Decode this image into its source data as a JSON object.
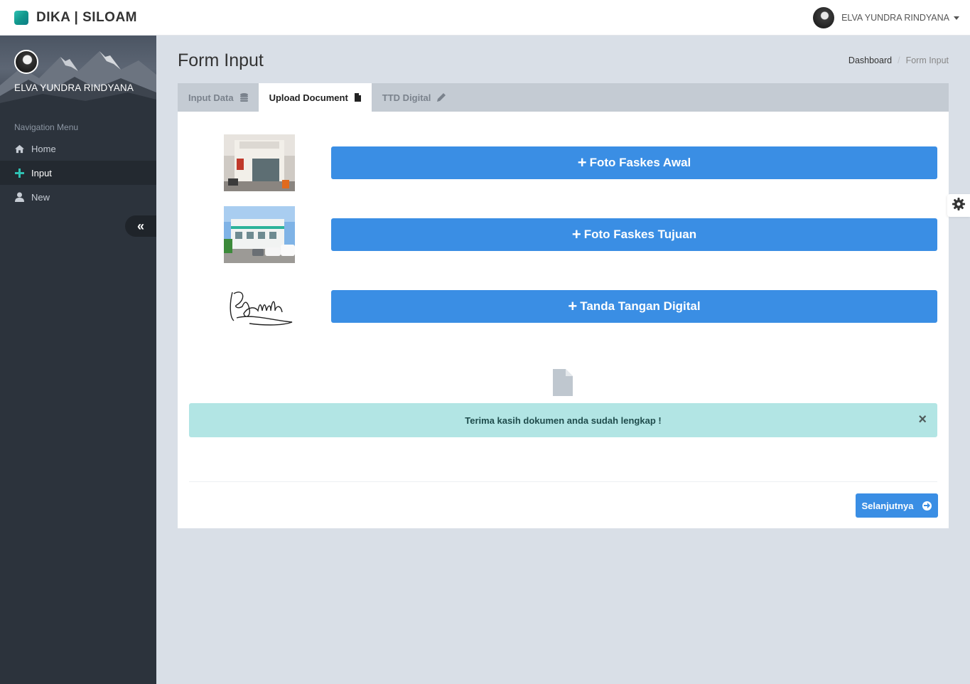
{
  "brand": {
    "name": "DIKA | SILOAM"
  },
  "top_user": {
    "name": "ELVA YUNDRA RINDYANA"
  },
  "sidebar": {
    "profile_name": "ELVA YUNDRA RINDYANA",
    "nav_header": "Navigation Menu",
    "items": [
      {
        "label": "Home",
        "icon": "home-icon"
      },
      {
        "label": "Input",
        "icon": "plus-icon",
        "active": true
      },
      {
        "label": "New",
        "icon": "user-icon"
      }
    ],
    "collapse_icon": "double-chevron-left-icon"
  },
  "page": {
    "title": "Form Input",
    "breadcrumb": [
      "Dashboard",
      "Form Input"
    ]
  },
  "tabs": [
    {
      "label": "Input Data",
      "icon": "database-icon"
    },
    {
      "label": "Upload Document",
      "icon": "file-icon",
      "active": true
    },
    {
      "label": "TTD Digital",
      "icon": "pencil-icon"
    }
  ],
  "uploads": [
    {
      "label": "Foto Faskes Awal",
      "thumbnail": "building-photo"
    },
    {
      "label": "Foto Faskes Tujuan",
      "thumbnail": "building-photo"
    },
    {
      "label": "Tanda Tangan Digital",
      "thumbnail": "signature-image"
    }
  ],
  "alert": {
    "message": "Terima kasih dokumen anda sudah lengkap !",
    "close": "×"
  },
  "next_button": {
    "label": "Selanjutnya",
    "icon": "arrow-circle-right-icon"
  },
  "colors": {
    "primary": "#3a8ee4",
    "alert_bg": "#b2e5e4",
    "sidebar": "#2c333c",
    "accent": "#2fc1b3"
  }
}
